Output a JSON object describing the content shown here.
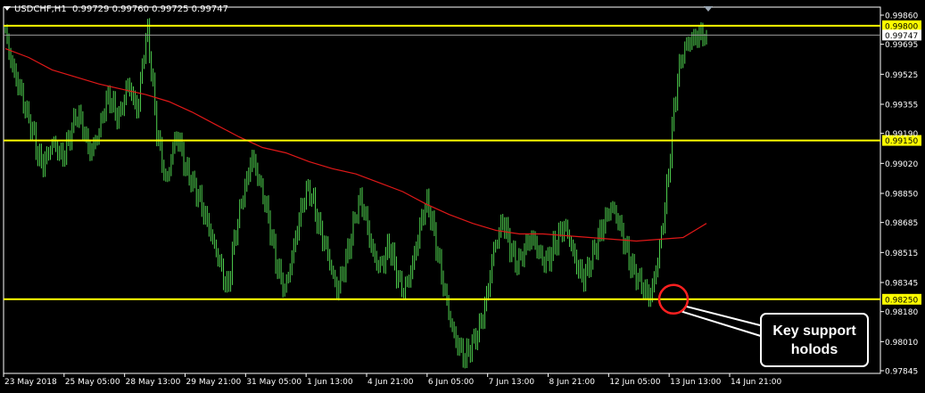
{
  "header": {
    "symbol": "USDCHF,H1",
    "ohlc": "0.99729 0.99760 0.99725 0.99747"
  },
  "colors": {
    "background": "#000000",
    "bars": "#4fd24f",
    "moving_average": "#e01818",
    "levels": "#ffff00",
    "axis": "#ffffff",
    "current_price": "#ffffff",
    "callout_circle": "#ff2020"
  },
  "chart_data": {
    "type": "bar",
    "title": "USDCHF,H1",
    "x_tick_labels": [
      "23 May 2018",
      "25 May 05:00",
      "28 May 13:00",
      "29 May 21:00",
      "31 May 05:00",
      "1 Jun 13:00",
      "4 Jun 21:00",
      "6 Jun 05:00",
      "7 Jun 13:00",
      "8 Jun 21:00",
      "12 Jun 05:00",
      "13 Jun 13:00",
      "14 Jun 21:00"
    ],
    "y_tick_labels": [
      "0.99860",
      "0.99695",
      "0.99525",
      "0.99355",
      "0.99190",
      "0.99020",
      "0.98850",
      "0.98685",
      "0.98515",
      "0.98345",
      "0.98180",
      "0.98010",
      "0.97845"
    ],
    "ylim": [
      0.97845,
      0.9986
    ],
    "horizontal_levels": [
      {
        "label": "0.99800",
        "value": 0.998
      },
      {
        "label": "0.99150",
        "value": 0.9915
      },
      {
        "label": "0.98250",
        "value": 0.9825
      }
    ],
    "current_price": {
      "label": "0.99747",
      "value": 0.99747
    },
    "price_path": [
      [
        0.9976,
        0.9962,
        0.9952,
        0.9945,
        0.9935,
        0.9926,
        0.9918,
        0.9905,
        0.9902,
        0.9907,
        0.9914,
        0.991,
        0.9905,
        0.9912,
        0.9921,
        0.993,
        0.9926,
        0.9916,
        0.9908,
        0.9914,
        0.9922,
        0.9935,
        0.994,
        0.9932,
        0.9928,
        0.9938,
        0.9948,
        0.9938,
        0.9932,
        0.996,
        0.9978,
        0.995,
        0.992,
        0.9905
      ],
      [
        0.989,
        0.9905,
        0.9918,
        0.9912,
        0.9899,
        0.9894,
        0.9888,
        0.9882,
        0.9873,
        0.9866,
        0.9856,
        0.9848,
        0.9838,
        0.983,
        0.9852,
        0.9868,
        0.9882,
        0.9892,
        0.9906,
        0.9898,
        0.9888,
        0.9878,
        0.9864,
        0.9848,
        0.9838,
        0.983,
        0.9842,
        0.9856,
        0.987,
        0.9882,
        0.9888,
        0.988,
        0.9868,
        0.986
      ],
      [
        0.9852,
        0.984,
        0.983,
        0.9838,
        0.9848,
        0.986,
        0.9874,
        0.9882,
        0.9872,
        0.9858,
        0.9848,
        0.9843,
        0.9848,
        0.9856,
        0.9846,
        0.9836,
        0.983,
        0.9835,
        0.9845,
        0.9858,
        0.9872,
        0.988,
        0.987,
        0.9855,
        0.984,
        0.9826,
        0.9812,
        0.9802,
        0.9797,
        0.9792,
        0.9797,
        0.9802,
        0.9808,
        0.9818,
        0.9832,
        0.9852
      ],
      [
        0.986,
        0.987,
        0.9861,
        0.9851,
        0.9845,
        0.9849,
        0.9856,
        0.986,
        0.9856,
        0.9849,
        0.9846,
        0.985,
        0.9856,
        0.9862,
        0.9867,
        0.986,
        0.985,
        0.9842,
        0.9837,
        0.9842,
        0.985,
        0.9858,
        0.9866,
        0.9872,
        0.9878,
        0.9872,
        0.9864,
        0.9854,
        0.9845,
        0.9839,
        0.9835,
        0.983,
        0.9826,
        0.9836,
        0.9852,
        0.9872,
        0.9896,
        0.9928,
        0.9952,
        0.9964,
        0.997,
        0.9972,
        0.9974,
        0.9975,
        0.99747
      ]
    ],
    "moving_average": [
      0.9967,
      0.9962,
      0.9955,
      0.9951,
      0.9947,
      0.9944,
      0.9941,
      0.9937,
      0.9931,
      0.9924,
      0.9917,
      0.9911,
      0.9908,
      0.9903,
      0.9899,
      0.9896,
      0.9891,
      0.9886,
      0.9879,
      0.9873,
      0.9868,
      0.9864,
      0.9862,
      0.9862,
      0.9861,
      0.986,
      0.9859,
      0.9858,
      0.9859,
      0.986,
      0.9868
    ],
    "annotation": {
      "text_line1": "Key support",
      "text_line2": "holods",
      "target_value": 0.9825
    }
  }
}
